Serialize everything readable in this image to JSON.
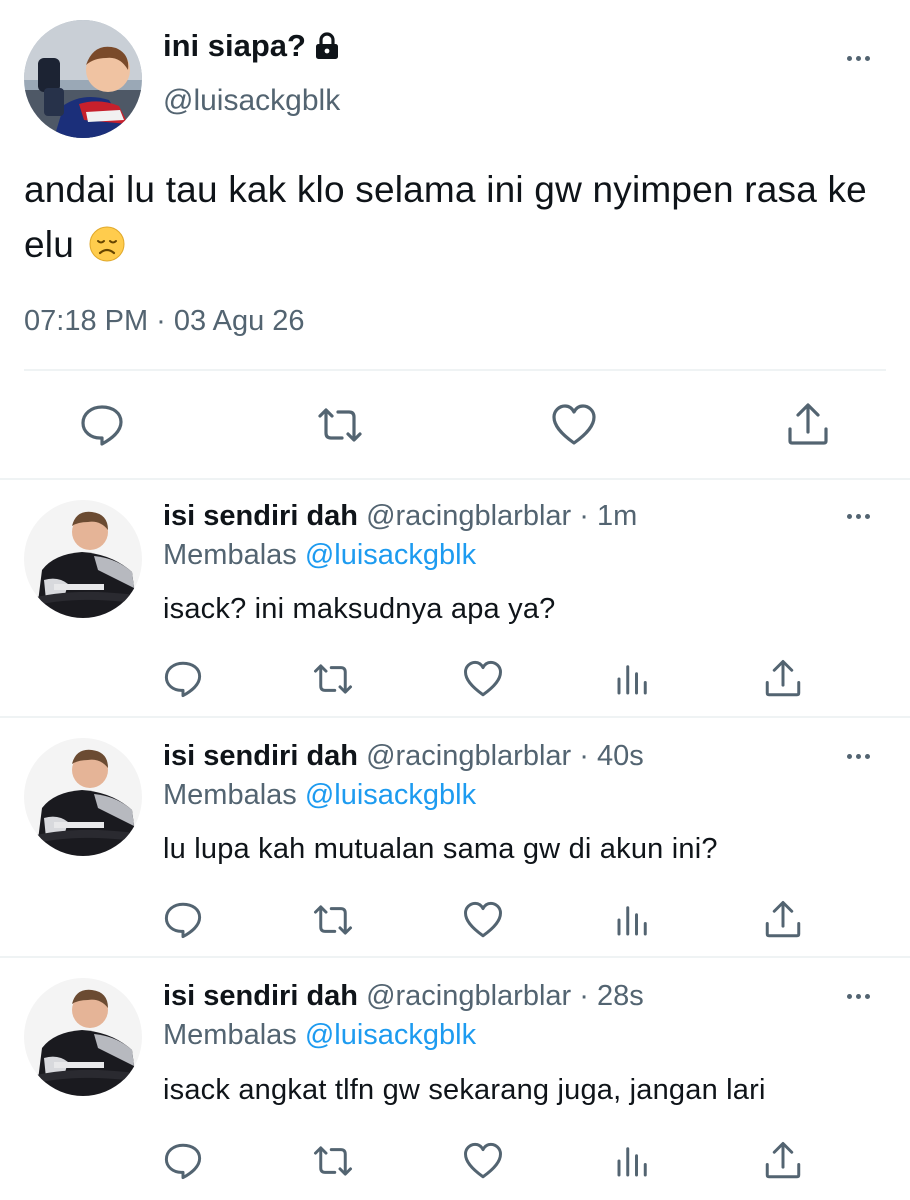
{
  "main_tweet": {
    "display_name": "ini siapa?",
    "handle": "@luisackgblk",
    "text": "andai lu tau kak klo selama ini gw nyimpen rasa ke elu",
    "timestamp": "07:18 PM · 03 Agu 26",
    "icons": [
      "lock-icon",
      "more-icon",
      "reply-icon",
      "retweet-icon",
      "like-icon",
      "share-icon",
      "disappointed-face-emoji"
    ]
  },
  "replies": [
    {
      "display_name": "isi sendiri dah",
      "handle": "@racingblarblar",
      "separator": "·",
      "time": "1m",
      "replying_label": "Membalas",
      "replying_to": "@luisackgblk",
      "text": "isack? ini maksudnya apa ya?"
    },
    {
      "display_name": "isi sendiri dah",
      "handle": "@racingblarblar",
      "separator": "·",
      "time": "40s",
      "replying_label": "Membalas",
      "replying_to": "@luisackgblk",
      "text": "lu lupa kah mutualan sama gw di akun ini?"
    },
    {
      "display_name": "isi sendiri dah",
      "handle": "@racingblarblar",
      "separator": "·",
      "time": "28s",
      "replying_label": "Membalas",
      "replying_to": "@luisackgblk",
      "text": "isack angkat tlfn gw sekarang juga, jangan lari"
    }
  ],
  "colors": {
    "text": "#0f1419",
    "muted": "#536471",
    "link": "#1d9bf0",
    "divider": "#eff3f4"
  }
}
